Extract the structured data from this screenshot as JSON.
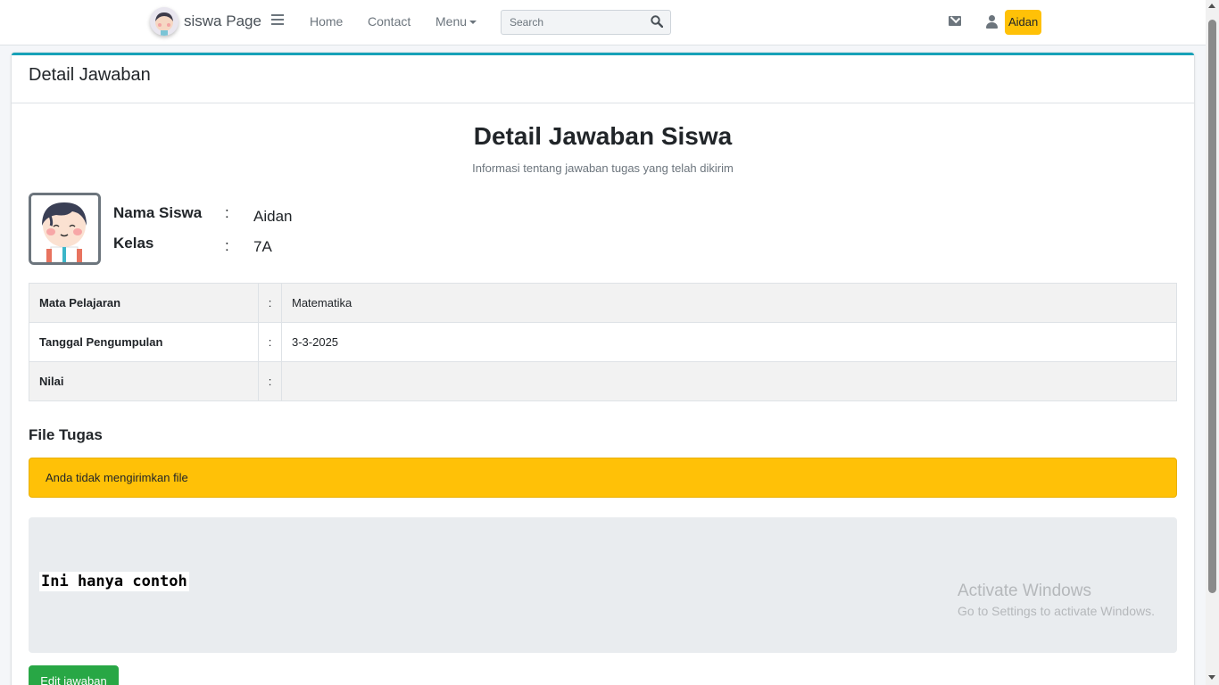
{
  "navbar": {
    "brand_text": "siswa Page",
    "links": {
      "home": "Home",
      "contact": "Contact",
      "menu": "Menu"
    },
    "search_placeholder": "Search",
    "user_name": "Aidan"
  },
  "card": {
    "header_title": "Detail Jawaban",
    "main_title": "Detail Jawaban Siswa",
    "subtitle": "Informasi tentang jawaban tugas yang telah dikirim"
  },
  "student": {
    "name_label": "Nama Siswa",
    "name_value": "Aidan",
    "class_label": "Kelas",
    "class_value": "7A",
    "colon": ":"
  },
  "details": [
    {
      "label": "Mata Pelajaran",
      "colon": ":",
      "value": "Matematika"
    },
    {
      "label": "Tanggal Pengumpulan",
      "colon": ":",
      "value": "3-3-2025"
    },
    {
      "label": "Nilai",
      "colon": ":",
      "value": ""
    }
  ],
  "file_section": {
    "title": "File Tugas",
    "alert_text": "Anda tidak mengirimkan file"
  },
  "answer": {
    "text": "Ini hanya contoh"
  },
  "watermark": {
    "line1": "Activate Windows",
    "line2": "Go to Settings to activate Windows."
  },
  "actions": {
    "edit_label": "Edit jawaban"
  },
  "colors": {
    "accent_top": "#17a2b8",
    "warning": "#ffc107",
    "success": "#28a745"
  }
}
